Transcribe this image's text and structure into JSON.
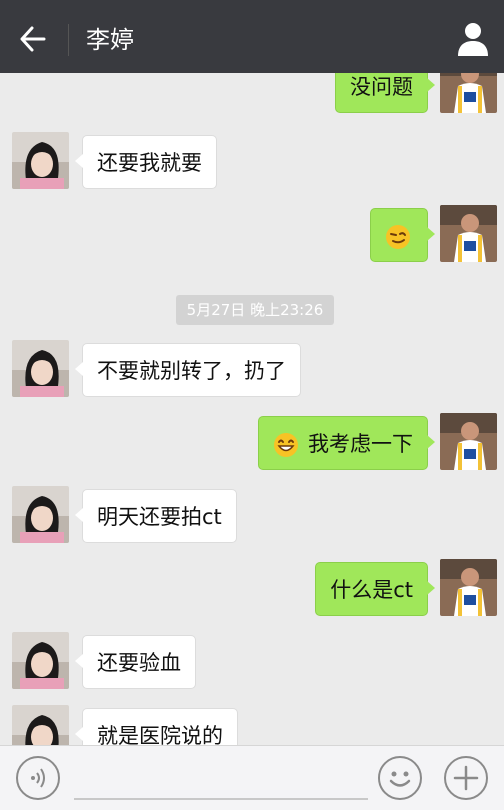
{
  "header": {
    "title": "李婷",
    "back_icon": "arrow-left-icon",
    "profile_icon": "user-icon",
    "bg_color": "#393a3f"
  },
  "messages": [
    {
      "side": "right",
      "text": "没问题"
    },
    {
      "side": "left",
      "text": "还要我就要"
    },
    {
      "side": "right",
      "emoji": "smirk-face-icon",
      "text": ""
    },
    {
      "timestamp": "5月27日 晚上23:26"
    },
    {
      "side": "left",
      "text": "不要就别转了，扔了"
    },
    {
      "side": "right",
      "emoji": "grinning-face-icon",
      "text": "我考虑一下"
    },
    {
      "side": "left",
      "text": "明天还要拍ct"
    },
    {
      "side": "right",
      "text": "什么是ct"
    },
    {
      "side": "left",
      "text": "还要验血"
    },
    {
      "side": "left",
      "text": "就是医院说的"
    }
  ],
  "footer": {
    "voice_icon": "voice-input-icon",
    "input_value": "",
    "emoji_icon": "emoji-icon",
    "plus_icon": "plus-icon"
  },
  "colors": {
    "sent_bubble": "#a0e75a",
    "received_bubble": "#ffffff",
    "chat_background": "#ebebeb"
  }
}
